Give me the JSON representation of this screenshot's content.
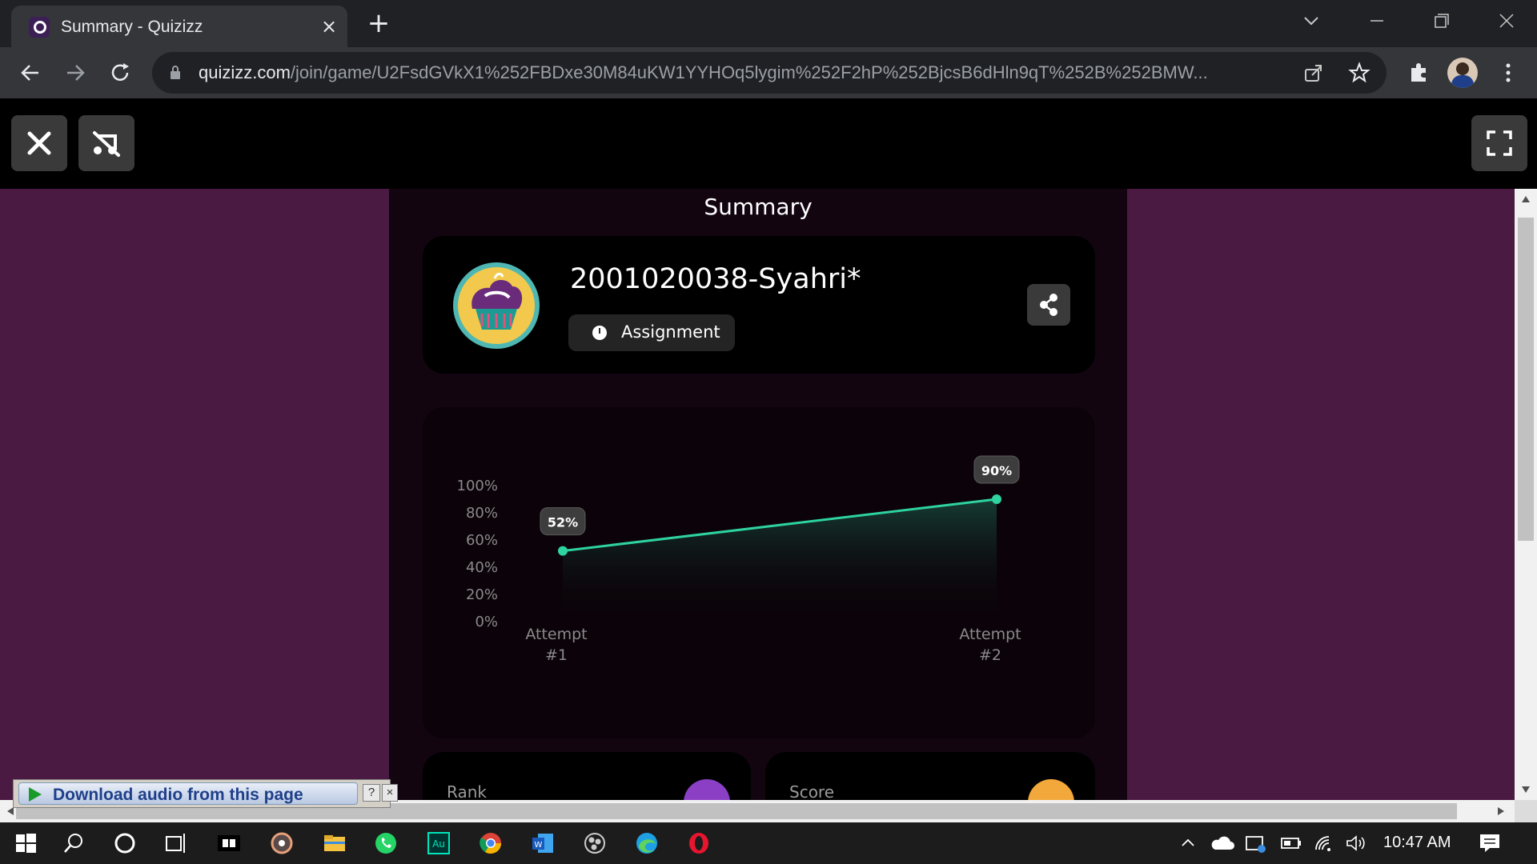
{
  "browser": {
    "tab_title": "Summary - Quizizz",
    "tab_close": "×",
    "new_tab": "+",
    "url_host": "quizizz.com",
    "url_path": "/join/game/U2FsdGVkX1%252FBDxe30M84uKW1YYHOq5lygim%252F2hP%252BjcsB6dHln9qT%252B%252BMW..."
  },
  "summary": {
    "page_title": "Summary",
    "player_name": "2001020038-Syahri*",
    "mode_label": "Assignment"
  },
  "chart_data": {
    "type": "area",
    "categories": [
      "Attempt #1",
      "Attempt #2"
    ],
    "category_lines": [
      [
        "Attempt",
        "#1"
      ],
      [
        "Attempt",
        "#2"
      ]
    ],
    "values": [
      52,
      90
    ],
    "value_labels": [
      "52%",
      "90%"
    ],
    "y_ticks": [
      "0%",
      "20%",
      "40%",
      "60%",
      "80%",
      "100%"
    ],
    "ylim": [
      0,
      100
    ],
    "line_color": "#2ed3a0",
    "grid": false
  },
  "stats": {
    "rank_label": "Rank",
    "score_label": "Score"
  },
  "extension": {
    "download_label": "Download audio from this page",
    "help": "?",
    "close": "×"
  },
  "taskbar": {
    "time": "10:47 AM"
  },
  "colors": {
    "background": "#4a1a42",
    "panel": "#120510",
    "card": "#000000",
    "accent_green": "#2ed3a0",
    "rank_icon": "#8a3fc4",
    "score_icon": "#f2a83a"
  }
}
